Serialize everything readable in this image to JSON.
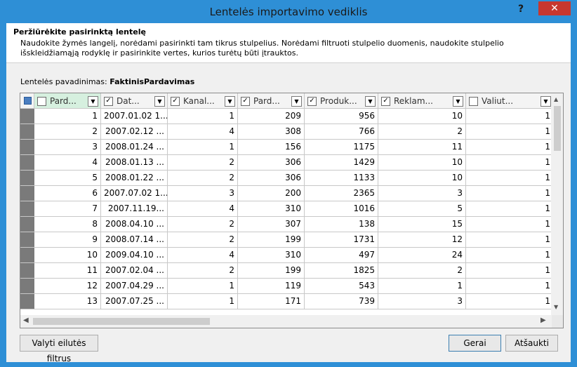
{
  "window": {
    "title": "Lentelės importavimo vediklis",
    "help": "?",
    "close": "✕"
  },
  "header": {
    "title": "Peržiūrėkite pasirinktą lentelę",
    "description": "Naudokite žymės langelį, norėdami pasirinkti tam tikrus stulpelius. Norėdami filtruoti stulpelio duomenis, naudokite stulpelio išskleidžiamąją rodyklę ir pasirinkite vertes, kurios turėtų būti įtrauktos."
  },
  "table_name": {
    "label": "Lentelės pavadinimas:",
    "value": "FaktinisPardavimas"
  },
  "columns": [
    {
      "label": "Pard...",
      "checked": false
    },
    {
      "label": "Dat...",
      "checked": true
    },
    {
      "label": "Kanal...",
      "checked": true
    },
    {
      "label": "Pard...",
      "checked": true
    },
    {
      "label": "Produk...",
      "checked": true
    },
    {
      "label": "Reklam...",
      "checked": true
    },
    {
      "label": "Valiut...",
      "checked": false
    }
  ],
  "rows": [
    [
      "1",
      "2007.01.02 1...",
      "1",
      "209",
      "956",
      "10",
      "1"
    ],
    [
      "2",
      "2007.02.12 ...",
      "4",
      "308",
      "766",
      "2",
      "1"
    ],
    [
      "3",
      "2008.01.24 ...",
      "1",
      "156",
      "1175",
      "11",
      "1"
    ],
    [
      "4",
      "2008.01.13 ...",
      "2",
      "306",
      "1429",
      "10",
      "1"
    ],
    [
      "5",
      "2008.01.22 ...",
      "2",
      "306",
      "1133",
      "10",
      "1"
    ],
    [
      "6",
      "2007.07.02 1...",
      "3",
      "200",
      "2365",
      "3",
      "1"
    ],
    [
      "7",
      "2007.11.19...",
      "4",
      "310",
      "1016",
      "5",
      "1"
    ],
    [
      "8",
      "2008.04.10 ...",
      "2",
      "307",
      "138",
      "15",
      "1"
    ],
    [
      "9",
      "2008.07.14 ...",
      "2",
      "199",
      "1731",
      "12",
      "1"
    ],
    [
      "10",
      "2009.04.10 ...",
      "4",
      "310",
      "497",
      "24",
      "1"
    ],
    [
      "11",
      "2007.02.04 ...",
      "2",
      "199",
      "1825",
      "2",
      "1"
    ],
    [
      "12",
      "2007.04.29 ...",
      "1",
      "119",
      "543",
      "1",
      "1"
    ],
    [
      "13",
      "2007.07.25 ...",
      "1",
      "171",
      "739",
      "3",
      "1"
    ]
  ],
  "buttons": {
    "clear_filters": "Valyti eilutės filtrus",
    "ok": "Gerai",
    "cancel": "Atšaukti"
  },
  "colors": {
    "accent": "#2e8fd6",
    "close": "#c7372f"
  }
}
